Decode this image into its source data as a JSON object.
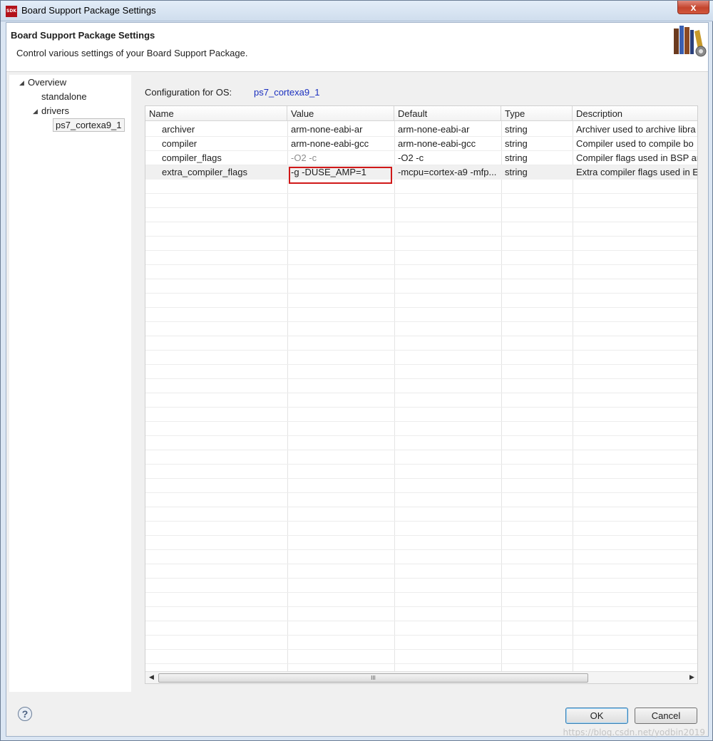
{
  "window": {
    "title": "Board Support Package Settings",
    "app_icon": "SDK",
    "close_label": "x"
  },
  "header": {
    "title": "Board Support Package Settings",
    "subtitle": "Control various settings of your Board Support Package.",
    "icon": "books-gear-icon"
  },
  "tree": {
    "items": [
      {
        "label": "Overview"
      },
      {
        "label": "standalone"
      },
      {
        "label": "drivers"
      },
      {
        "label": "ps7_cortexa9_1"
      }
    ]
  },
  "config": {
    "label": "Configuration for OS:",
    "os": "ps7_cortexa9_1"
  },
  "table": {
    "columns": [
      "Name",
      "Value",
      "Default",
      "Type",
      "Description"
    ],
    "rows": [
      {
        "name": "archiver",
        "value": "arm-none-eabi-ar",
        "default": "arm-none-eabi-ar",
        "type": "string",
        "description": "Archiver used to archive libra"
      },
      {
        "name": "compiler",
        "value": "arm-none-eabi-gcc",
        "default": "arm-none-eabi-gcc",
        "type": "string",
        "description": "Compiler used to compile bo"
      },
      {
        "name": "compiler_flags",
        "value": "-O2 -c",
        "default": "-O2 -c",
        "type": "string",
        "description": "Compiler flags used in BSP ar"
      },
      {
        "name": "extra_compiler_flags",
        "value": "-g -DUSE_AMP=1",
        "default": "-mcpu=cortex-a9 -mfp...",
        "type": "string",
        "description": "Extra compiler flags used in E"
      }
    ],
    "scroll_grip": "III"
  },
  "buttons": {
    "help": "?",
    "ok": "OK",
    "cancel": "Cancel"
  },
  "watermark": "https://blog.csdn.net/yodbin2019"
}
